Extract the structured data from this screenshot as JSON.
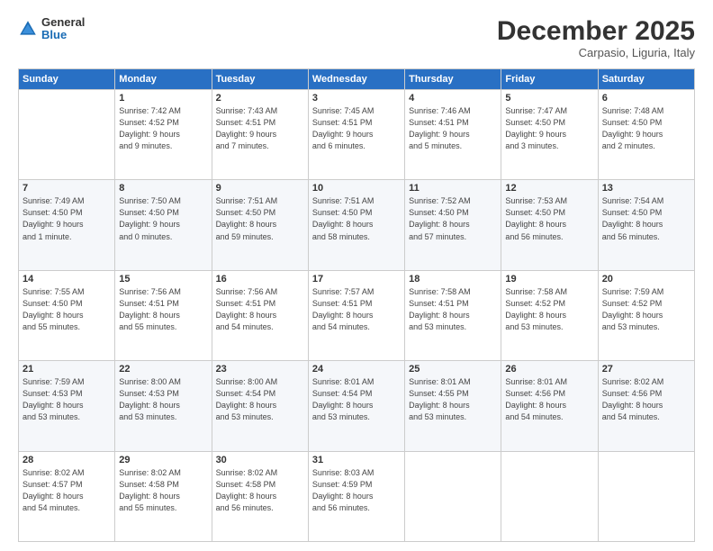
{
  "header": {
    "logo": {
      "line1": "General",
      "line2": "Blue"
    },
    "title": "December 2025",
    "subtitle": "Carpasio, Liguria, Italy"
  },
  "weekdays": [
    "Sunday",
    "Monday",
    "Tuesday",
    "Wednesday",
    "Thursday",
    "Friday",
    "Saturday"
  ],
  "weeks": [
    [
      {
        "num": "",
        "info": ""
      },
      {
        "num": "1",
        "info": "Sunrise: 7:42 AM\nSunset: 4:52 PM\nDaylight: 9 hours\nand 9 minutes."
      },
      {
        "num": "2",
        "info": "Sunrise: 7:43 AM\nSunset: 4:51 PM\nDaylight: 9 hours\nand 7 minutes."
      },
      {
        "num": "3",
        "info": "Sunrise: 7:45 AM\nSunset: 4:51 PM\nDaylight: 9 hours\nand 6 minutes."
      },
      {
        "num": "4",
        "info": "Sunrise: 7:46 AM\nSunset: 4:51 PM\nDaylight: 9 hours\nand 5 minutes."
      },
      {
        "num": "5",
        "info": "Sunrise: 7:47 AM\nSunset: 4:50 PM\nDaylight: 9 hours\nand 3 minutes."
      },
      {
        "num": "6",
        "info": "Sunrise: 7:48 AM\nSunset: 4:50 PM\nDaylight: 9 hours\nand 2 minutes."
      }
    ],
    [
      {
        "num": "7",
        "info": "Sunrise: 7:49 AM\nSunset: 4:50 PM\nDaylight: 9 hours\nand 1 minute."
      },
      {
        "num": "8",
        "info": "Sunrise: 7:50 AM\nSunset: 4:50 PM\nDaylight: 9 hours\nand 0 minutes."
      },
      {
        "num": "9",
        "info": "Sunrise: 7:51 AM\nSunset: 4:50 PM\nDaylight: 8 hours\nand 59 minutes."
      },
      {
        "num": "10",
        "info": "Sunrise: 7:51 AM\nSunset: 4:50 PM\nDaylight: 8 hours\nand 58 minutes."
      },
      {
        "num": "11",
        "info": "Sunrise: 7:52 AM\nSunset: 4:50 PM\nDaylight: 8 hours\nand 57 minutes."
      },
      {
        "num": "12",
        "info": "Sunrise: 7:53 AM\nSunset: 4:50 PM\nDaylight: 8 hours\nand 56 minutes."
      },
      {
        "num": "13",
        "info": "Sunrise: 7:54 AM\nSunset: 4:50 PM\nDaylight: 8 hours\nand 56 minutes."
      }
    ],
    [
      {
        "num": "14",
        "info": "Sunrise: 7:55 AM\nSunset: 4:50 PM\nDaylight: 8 hours\nand 55 minutes."
      },
      {
        "num": "15",
        "info": "Sunrise: 7:56 AM\nSunset: 4:51 PM\nDaylight: 8 hours\nand 55 minutes."
      },
      {
        "num": "16",
        "info": "Sunrise: 7:56 AM\nSunset: 4:51 PM\nDaylight: 8 hours\nand 54 minutes."
      },
      {
        "num": "17",
        "info": "Sunrise: 7:57 AM\nSunset: 4:51 PM\nDaylight: 8 hours\nand 54 minutes."
      },
      {
        "num": "18",
        "info": "Sunrise: 7:58 AM\nSunset: 4:51 PM\nDaylight: 8 hours\nand 53 minutes."
      },
      {
        "num": "19",
        "info": "Sunrise: 7:58 AM\nSunset: 4:52 PM\nDaylight: 8 hours\nand 53 minutes."
      },
      {
        "num": "20",
        "info": "Sunrise: 7:59 AM\nSunset: 4:52 PM\nDaylight: 8 hours\nand 53 minutes."
      }
    ],
    [
      {
        "num": "21",
        "info": "Sunrise: 7:59 AM\nSunset: 4:53 PM\nDaylight: 8 hours\nand 53 minutes."
      },
      {
        "num": "22",
        "info": "Sunrise: 8:00 AM\nSunset: 4:53 PM\nDaylight: 8 hours\nand 53 minutes."
      },
      {
        "num": "23",
        "info": "Sunrise: 8:00 AM\nSunset: 4:54 PM\nDaylight: 8 hours\nand 53 minutes."
      },
      {
        "num": "24",
        "info": "Sunrise: 8:01 AM\nSunset: 4:54 PM\nDaylight: 8 hours\nand 53 minutes."
      },
      {
        "num": "25",
        "info": "Sunrise: 8:01 AM\nSunset: 4:55 PM\nDaylight: 8 hours\nand 53 minutes."
      },
      {
        "num": "26",
        "info": "Sunrise: 8:01 AM\nSunset: 4:56 PM\nDaylight: 8 hours\nand 54 minutes."
      },
      {
        "num": "27",
        "info": "Sunrise: 8:02 AM\nSunset: 4:56 PM\nDaylight: 8 hours\nand 54 minutes."
      }
    ],
    [
      {
        "num": "28",
        "info": "Sunrise: 8:02 AM\nSunset: 4:57 PM\nDaylight: 8 hours\nand 54 minutes."
      },
      {
        "num": "29",
        "info": "Sunrise: 8:02 AM\nSunset: 4:58 PM\nDaylight: 8 hours\nand 55 minutes."
      },
      {
        "num": "30",
        "info": "Sunrise: 8:02 AM\nSunset: 4:58 PM\nDaylight: 8 hours\nand 56 minutes."
      },
      {
        "num": "31",
        "info": "Sunrise: 8:03 AM\nSunset: 4:59 PM\nDaylight: 8 hours\nand 56 minutes."
      },
      {
        "num": "",
        "info": ""
      },
      {
        "num": "",
        "info": ""
      },
      {
        "num": "",
        "info": ""
      }
    ]
  ]
}
